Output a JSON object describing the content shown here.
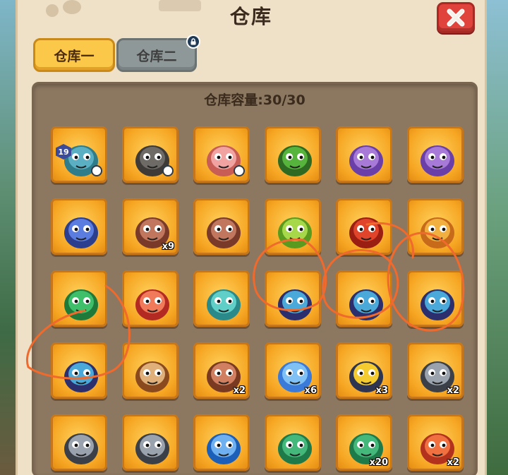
{
  "window": {
    "title": "仓库"
  },
  "tabs": [
    {
      "label": "仓库一",
      "active": true
    },
    {
      "label": "仓库二",
      "active": false,
      "locked": true
    }
  ],
  "storage": {
    "capacity_label": "仓库容量:",
    "capacity_value": "30/30"
  },
  "slots": [
    {
      "icon": "equipment-set-icon",
      "qty": "",
      "level": "19"
    },
    {
      "icon": "thorn-crown-icon",
      "qty": ""
    },
    {
      "icon": "crossbow-icon",
      "qty": ""
    },
    {
      "icon": "green-potion-icon",
      "qty": ""
    },
    {
      "icon": "purple-wolf-pet-icon",
      "qty": ""
    },
    {
      "icon": "purple-wolf-pet-icon",
      "qty": ""
    },
    {
      "icon": "blue-wolf-pet-icon",
      "qty": ""
    },
    {
      "icon": "gorilla-pet-icon",
      "qty": "x9"
    },
    {
      "icon": "gorilla-pet-icon",
      "qty": ""
    },
    {
      "icon": "green-triceratops-pet-icon",
      "qty": ""
    },
    {
      "icon": "red-fire-pet-icon",
      "qty": ""
    },
    {
      "icon": "goggles-pet-icon",
      "qty": ""
    },
    {
      "icon": "green-dino-pet-icon",
      "qty": ""
    },
    {
      "icon": "red-hair-girl-pet-icon",
      "qty": ""
    },
    {
      "icon": "teal-crown-pet-icon",
      "qty": ""
    },
    {
      "icon": "tophat-bat-pet-icon",
      "qty": ""
    },
    {
      "icon": "tophat-bat-pet-icon",
      "qty": ""
    },
    {
      "icon": "tophat-bat-pet-icon",
      "qty": ""
    },
    {
      "icon": "tophat-bat-pet-icon",
      "qty": ""
    },
    {
      "icon": "brown-dog-pet-icon",
      "qty": ""
    },
    {
      "icon": "brown-raptor-pet-icon",
      "qty": "x2"
    },
    {
      "icon": "blue-blob-pet-icon",
      "qty": "x6"
    },
    {
      "icon": "yellow-goggle-pet-icon",
      "qty": "x3"
    },
    {
      "icon": "gray-cat-pet-icon",
      "qty": "x2"
    },
    {
      "icon": "gray-cat-pet-icon",
      "qty": ""
    },
    {
      "icon": "gray-cat-pet-icon",
      "qty": ""
    },
    {
      "icon": "blue-whale-pet-icon",
      "qty": ""
    },
    {
      "icon": "green-turtle-pet-icon",
      "qty": ""
    },
    {
      "icon": "green-turtle-pet-icon",
      "qty": "x20"
    },
    {
      "icon": "red-raptor-pet-icon",
      "qty": "x2"
    }
  ],
  "colors": {
    "slot_gold": "#f6a623",
    "close_red": "#e0433b",
    "tab_active": "#fcc84a",
    "annotation_orange": "#ef6a2c"
  }
}
